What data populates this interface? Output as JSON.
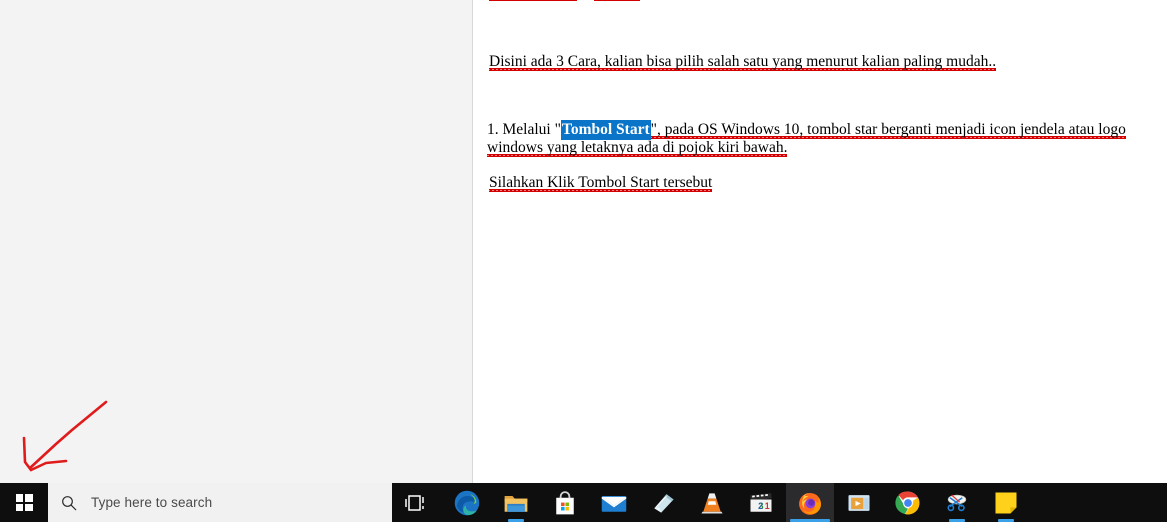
{
  "window": {
    "left_panel_bg": "#f3f3f3",
    "document_bg": "#ffffff"
  },
  "document": {
    "cut_off_line_note": "partially visible line of red spell-check squiggles at top edge",
    "paragraphs": [
      {
        "id": "intro",
        "text": "Disini ada 3 Cara, kalian bisa pilih salah satu yang menurut kalian paling mudah.."
      },
      {
        "id": "step1",
        "prefix": "1. Melalui \"",
        "highlight": "Tombol Start",
        "suffix": "\", pada OS Windows 10, tombol star berganti menjadi icon jendela atau logo windows yang letaknya ada di pojok kiri bawah."
      },
      {
        "id": "last",
        "text": "Silahkan Klik Tombol Start tersebut"
      }
    ],
    "highlight_color": "#0a74c8",
    "highlight_text_color": "#ffffff",
    "spellcheck_underline_color": "#d40000"
  },
  "annotation": {
    "name": "red-arrow",
    "color": "#e01b1b",
    "points_to": "start-button"
  },
  "taskbar": {
    "background": "#0e0e0f",
    "start_button": {
      "label": "Start",
      "icon": "windows-logo-icon"
    },
    "search": {
      "placeholder": "Type here to search",
      "icon": "search-icon",
      "background": "#f1f1f1"
    },
    "indicator_color": "#3aa0e8",
    "items": [
      {
        "name": "task-view",
        "icon": "task-view-icon",
        "label": "Task View",
        "active": false,
        "indicator": "none"
      },
      {
        "name": "microsoft-edge",
        "icon": "edge-icon",
        "label": "Microsoft Edge",
        "active": false,
        "indicator": "none"
      },
      {
        "name": "file-explorer",
        "icon": "folder-icon",
        "label": "File Explorer",
        "active": false,
        "indicator": "narrow"
      },
      {
        "name": "microsoft-store",
        "icon": "store-bag-icon",
        "label": "Microsoft Store",
        "active": false,
        "indicator": "none"
      },
      {
        "name": "mail",
        "icon": "mail-envelope-icon",
        "label": "Mail",
        "active": false,
        "indicator": "none"
      },
      {
        "name": "sticky-notes-app",
        "icon": "onenote-page-icon",
        "label": "OneNote",
        "active": false,
        "indicator": "none"
      },
      {
        "name": "vlc-media-player",
        "icon": "vlc-cone-icon",
        "label": "VLC media player",
        "active": false,
        "indicator": "none"
      },
      {
        "name": "media-player-321",
        "icon": "mpc-clapper-321-icon",
        "label": "Media Player Classic",
        "active": false,
        "indicator": "none"
      },
      {
        "name": "mozilla-firefox",
        "icon": "firefox-icon",
        "label": "Mozilla Firefox",
        "active": true,
        "indicator": "wide"
      },
      {
        "name": "movies-tv",
        "icon": "media-play-window-icon",
        "label": "Movies & TV",
        "active": false,
        "indicator": "none"
      },
      {
        "name": "google-chrome",
        "icon": "chrome-icon",
        "label": "Google Chrome",
        "active": false,
        "indicator": "none"
      },
      {
        "name": "snipping-tool",
        "icon": "scissors-icon",
        "label": "Snipping Tool",
        "active": false,
        "indicator": "narrow"
      },
      {
        "name": "sticky-notes",
        "icon": "sticky-note-icon",
        "label": "Sticky Notes",
        "active": false,
        "indicator": "narrow"
      }
    ]
  }
}
